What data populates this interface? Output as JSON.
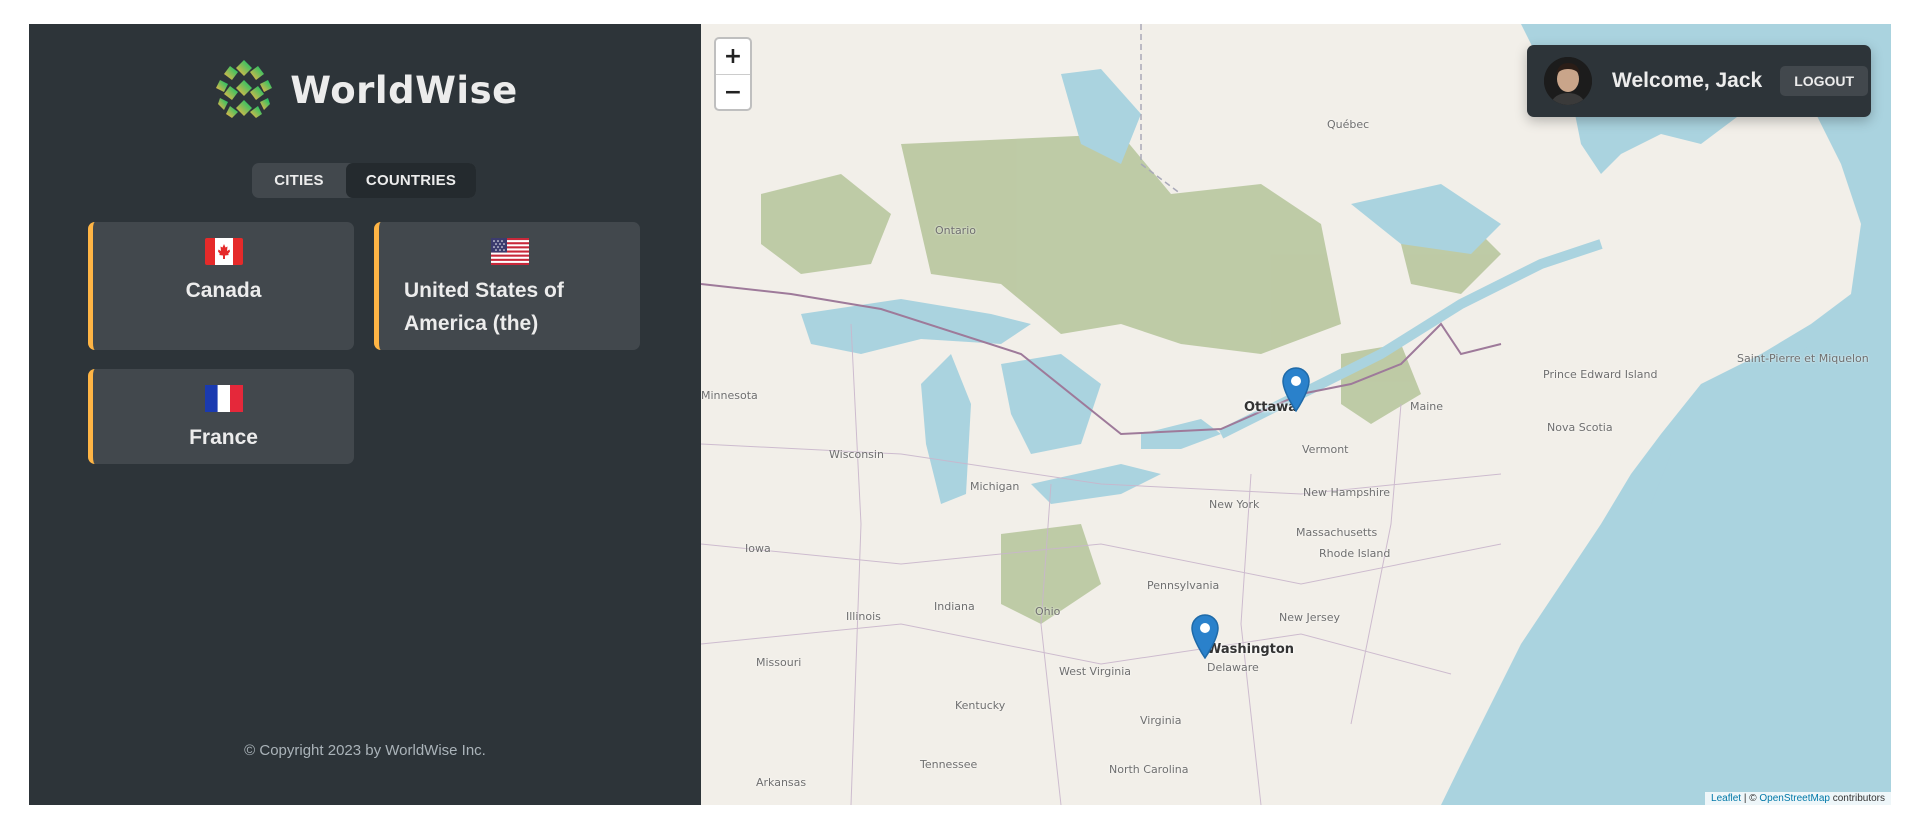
{
  "app": {
    "name": "WorldWise"
  },
  "tabs": {
    "cities": "CITIES",
    "countries": "COUNTRIES",
    "active": "countries"
  },
  "countries": [
    {
      "name": "Canada",
      "flag": "canada-flag"
    },
    {
      "name": "United States of America (the)",
      "flag": "usa-flag"
    },
    {
      "name": "France",
      "flag": "france-flag"
    }
  ],
  "footer": {
    "copyright": "© Copyright 2023 by WorldWise Inc."
  },
  "map": {
    "zoom_in": "+",
    "zoom_out": "−",
    "cities": [
      "Ottawa",
      "Washington"
    ],
    "regions": [
      "Québec",
      "Ontario",
      "Minnesota",
      "Wisconsin",
      "Michigan",
      "Iowa",
      "Illinois",
      "Indiana",
      "Ohio",
      "Missouri",
      "Kentucky",
      "Tennessee",
      "Arkansas",
      "Pennsylvania",
      "New York",
      "Vermont",
      "Maine",
      "New Hampshire",
      "Massachusetts",
      "Rhode Island",
      "New Jersey",
      "Delaware",
      "West Virginia",
      "Virginia",
      "North Carolina",
      "Prince Edward Island",
      "Nova Scotia",
      "Saint-Pierre et Miquelon"
    ],
    "attribution": {
      "leaflet": "Leaflet",
      "separator": " | © ",
      "osm": "OpenStreetMap",
      "suffix": " contributors"
    }
  },
  "user": {
    "welcome": "Welcome, Jack",
    "logout": "LOGOUT"
  },
  "colors": {
    "sidebar": "#2d3439",
    "card": "#42484d",
    "accent": "#ffb545",
    "water": "#aad3df",
    "land": "#f2efe9",
    "forest": "#b5c49a",
    "marker": "#2a81cb"
  }
}
